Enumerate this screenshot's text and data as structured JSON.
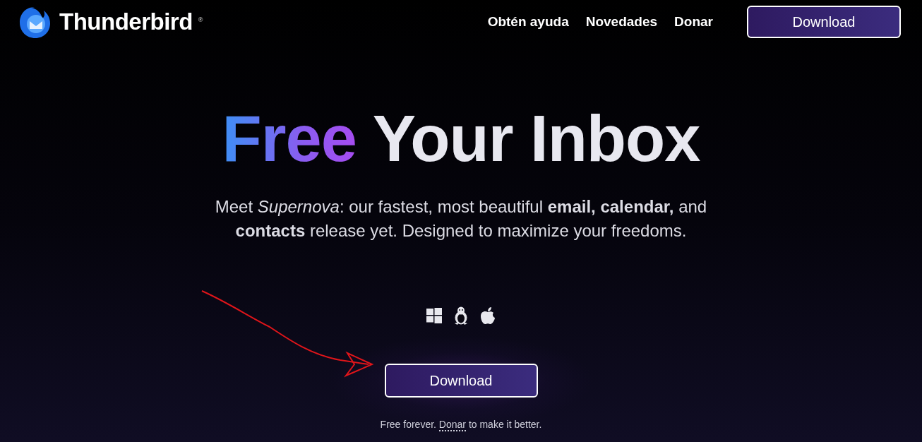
{
  "navbar": {
    "brand": "Thunderbird",
    "registered": "®",
    "links": [
      {
        "label": "Obtén ayuda"
      },
      {
        "label": "Novedades"
      },
      {
        "label": "Donar"
      }
    ],
    "download": "Download"
  },
  "hero": {
    "title_highlight": "Free",
    "title_rest": "Your Inbox",
    "subtitle": "Meet *Supernova*: our fastest, most beautiful **email, calendar,** and **contacts** release yet. Designed to maximize your freedoms.",
    "platforms": [
      {
        "kind": "windows"
      },
      {
        "kind": "linux"
      },
      {
        "kind": "apple"
      }
    ],
    "download": "Download",
    "footnote": {
      "before": "Free forever. ",
      "link": "Donar",
      "after": " to make it better."
    }
  },
  "annotation": {
    "kind": "arrow",
    "color": "#e0151a"
  }
}
